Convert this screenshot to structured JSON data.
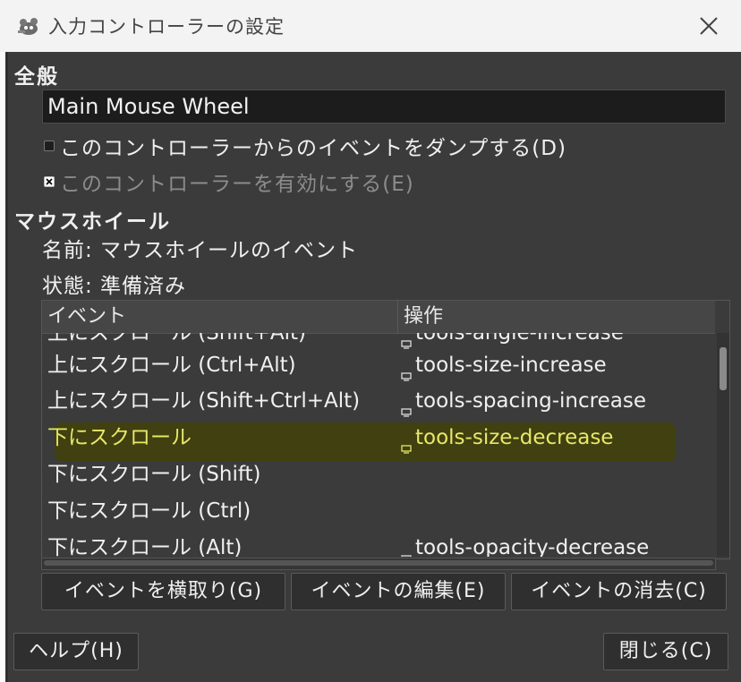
{
  "window": {
    "title": "入力コントローラーの設定",
    "app_icon": "gimp-wilber-icon"
  },
  "general": {
    "heading": "全般",
    "controller_name": "Main Mouse Wheel",
    "dump_events_label": "このコントローラーからのイベントをダンプする(D)",
    "dump_events_checked": false,
    "enable_label": "このコントローラーを有効にする(E)",
    "enable_checked": true
  },
  "mouse_wheel": {
    "heading": "マウスホイール",
    "name_line": "名前: マウスホイールのイベント",
    "state_line": "状態: 準備済み"
  },
  "table": {
    "columns": [
      "イベント",
      "操作"
    ],
    "rows": [
      {
        "event": "上にスクロール (Shift+Alt)",
        "action": "tools-angle-increase"
      },
      {
        "event": "上にスクロール (Ctrl+Alt)",
        "action": "tools-size-increase"
      },
      {
        "event": "上にスクロール (Shift+Ctrl+Alt)",
        "action": "tools-spacing-increase"
      },
      {
        "event": "下にスクロール",
        "action": "tools-size-decrease",
        "selected": true
      },
      {
        "event": "下にスクロール (Shift)",
        "action": ""
      },
      {
        "event": "下にスクロール (Ctrl)",
        "action": ""
      },
      {
        "event": "下にスクロール (Alt)",
        "action": "tools-opacity-decrease"
      }
    ]
  },
  "buttons": {
    "grab_event": "イベントを横取り(G)",
    "edit_event": "イベントの編集(E)",
    "clear_event": "イベントの消去(C)",
    "help": "ヘルプ(H)",
    "close": "閉じる(C)"
  },
  "colors": {
    "background": "#3b3b3b",
    "selected_text": "#e8e86a",
    "highlight": "#404010"
  }
}
